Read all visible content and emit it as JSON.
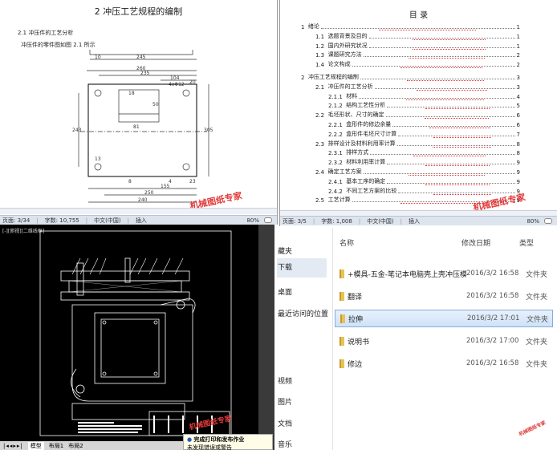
{
  "doc1": {
    "chapter_title": "2  冲压工艺规程的编制",
    "section": "2.1 冲压件的工艺分析",
    "body": "冲压件的零件图如图 2.1 所示",
    "dims": {
      "d10": "10",
      "d245": "245",
      "d260": "260",
      "d235": "235",
      "d104": "104",
      "d20": "20",
      "holes": "4xΦ12",
      "d18": "18",
      "d81": "81",
      "d50": "50",
      "d243": "243",
      "d305": "305",
      "d13": "13",
      "d8": "8",
      "d4": "4",
      "d23": "23",
      "d155": "155",
      "d250": "250",
      "d240": "240"
    },
    "watermark": "机械图纸专家",
    "status": {
      "page": "页面: 3/34",
      "words": "字数: 10,755",
      "lang": "中文(中国)",
      "mode": "插入",
      "zoom": "80%"
    }
  },
  "doc2": {
    "toc_title": "目    录",
    "toc": [
      {
        "num": "1",
        "title": "绪论",
        "page": "1",
        "level": 0
      },
      {
        "num": "1.1",
        "title": "选题背景及目的",
        "page": "1",
        "level": 1
      },
      {
        "num": "1.2",
        "title": "国内外研究状况",
        "page": "1",
        "level": 1
      },
      {
        "num": "1.3",
        "title": "课题研究方法",
        "page": "2",
        "level": 1
      },
      {
        "num": "1.4",
        "title": "论文构成",
        "page": "2",
        "level": 1
      },
      {
        "num": "2",
        "title": "冲压工艺规程的编制",
        "page": "3",
        "level": 0
      },
      {
        "num": "2.1",
        "title": "冲压件的工艺分析",
        "page": "3",
        "level": 1
      },
      {
        "num": "2.1.1",
        "title": "材料",
        "page": "4",
        "level": 2
      },
      {
        "num": "2.1.2",
        "title": "结构工艺性分析",
        "page": "5",
        "level": 2
      },
      {
        "num": "2.2",
        "title": "毛坯形状、尺寸的确定",
        "page": "6",
        "level": 1
      },
      {
        "num": "2.2.1",
        "title": "盒形件的修边余量",
        "page": "6",
        "level": 2
      },
      {
        "num": "2.2.2",
        "title": "盒形件毛坯尺寸计算",
        "page": "7",
        "level": 2
      },
      {
        "num": "2.3",
        "title": "排样设计及材料利用率计算",
        "page": "8",
        "level": 1
      },
      {
        "num": "2.3.1",
        "title": "排样方式",
        "page": "8",
        "level": 2
      },
      {
        "num": "2.3.2",
        "title": "材料利用率计算",
        "page": "9",
        "level": 2
      },
      {
        "num": "2.4",
        "title": "确定工艺方案",
        "page": "9",
        "level": 1
      },
      {
        "num": "2.4.1",
        "title": "基本工序的确定",
        "page": "9",
        "level": 2
      },
      {
        "num": "2.4.2",
        "title": "不同工艺方案的比较",
        "page": "9",
        "level": 2
      },
      {
        "num": "2.5",
        "title": "工艺计算",
        "page": "9",
        "level": 1
      }
    ],
    "watermark": "机械图纸专家",
    "status": {
      "page": "页面: 3/5",
      "words": "字数: 1,008",
      "lang": "中文(中国)",
      "mode": "插入",
      "zoom": "80%"
    }
  },
  "cad": {
    "viewport_label": "[-][俯视][二维线框]",
    "tabs": [
      "模型",
      "布局1",
      "布局2"
    ],
    "toast_title": "完成打印和发布作业",
    "toast_body": "未发现错误或警告",
    "watermark": "机械图纸专家"
  },
  "explorer": {
    "sidebar": [
      "藏夹",
      "下载",
      "桌面",
      "最近访问的位置",
      "视频",
      "图片",
      "文档",
      "音乐"
    ],
    "selected_sidebar": 1,
    "columns": {
      "name": "名称",
      "date": "修改日期",
      "type": "类型"
    },
    "files": [
      {
        "name": "+模具-五金-笔记本电脑壳上壳冲压模设计",
        "date": "2016/3/2 16:58",
        "type": "文件夹"
      },
      {
        "name": "翻译",
        "date": "2016/3/2 16:58",
        "type": "文件夹"
      },
      {
        "name": "拉伸",
        "date": "2016/3/2 17:01",
        "type": "文件夹"
      },
      {
        "name": "说明书",
        "date": "2016/3/2 17:00",
        "type": "文件夹"
      },
      {
        "name": "修边",
        "date": "2016/3/2 16:58",
        "type": "文件夹"
      }
    ],
    "selected_file": 2,
    "watermark": "机械图纸专家"
  },
  "colors": {
    "watermark": "#e23a3a",
    "cad_bg": "#000000",
    "selection": "#cfe2f8"
  }
}
